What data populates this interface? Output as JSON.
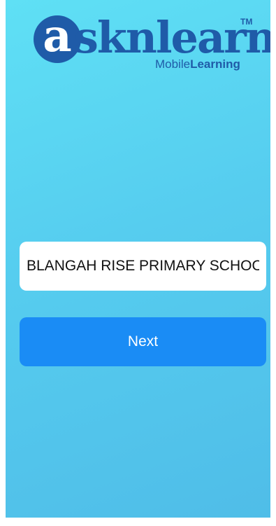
{
  "logo": {
    "letter": "a",
    "word": "sknlearn",
    "trademark": "TM",
    "sub_prefix": "Mobile",
    "sub_bold": "Learning"
  },
  "school_field": {
    "value": "BLANGAH RISE PRIMARY SCHOOL"
  },
  "next_button": {
    "label": "Next"
  },
  "colors": {
    "background_top": "#5fe0f5",
    "background_bottom": "#4fbde8",
    "brand": "#1f5ba8",
    "button": "#1a8cf5"
  }
}
